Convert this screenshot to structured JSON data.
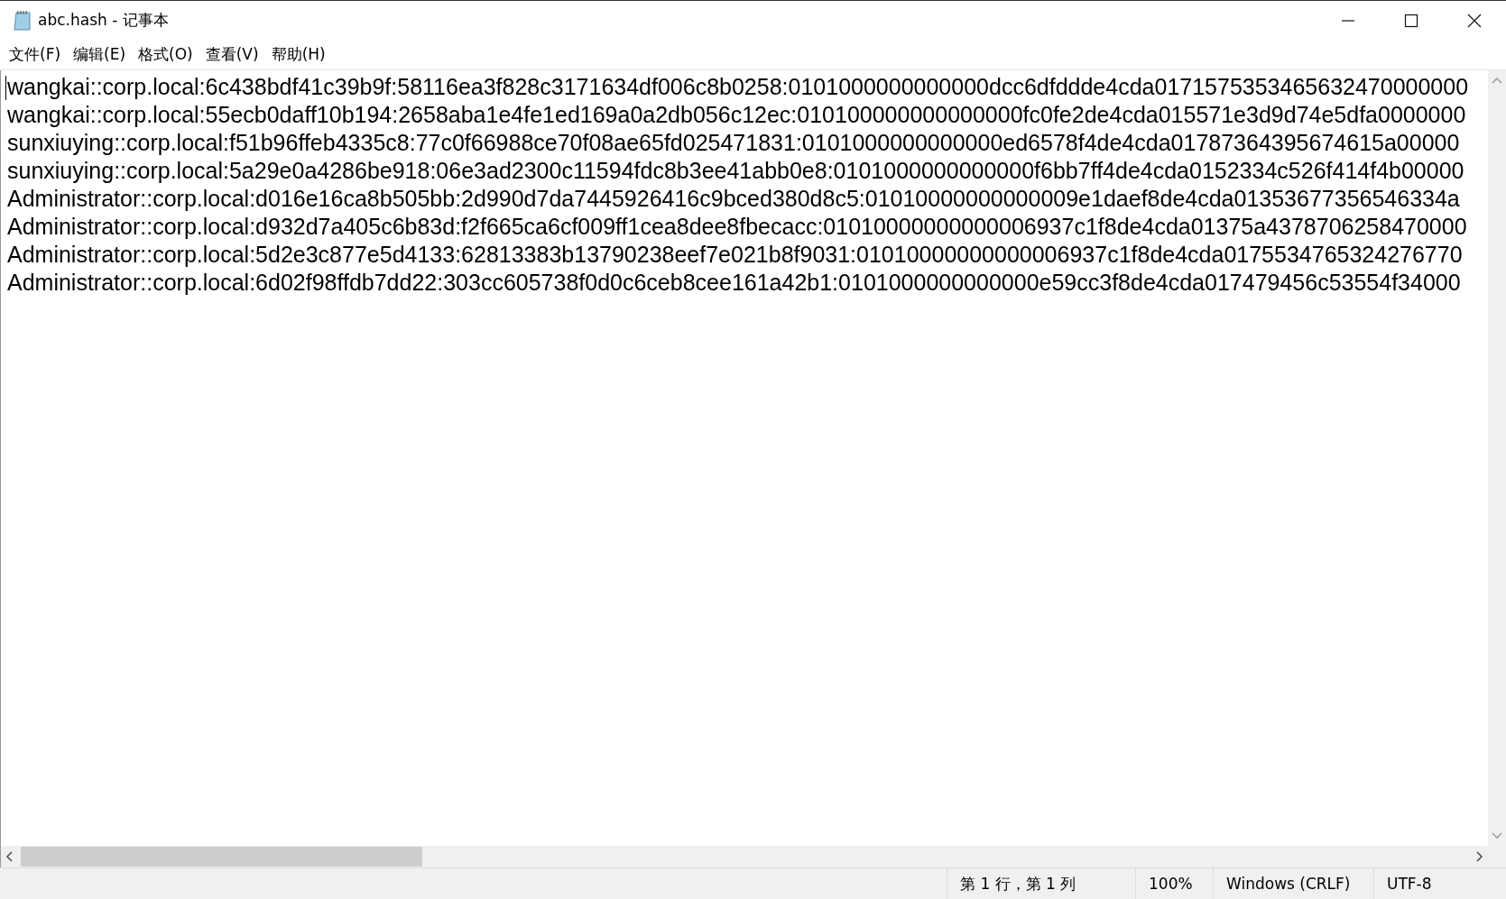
{
  "window": {
    "title": "abc.hash - 记事本"
  },
  "menu": [
    "文件(F)",
    "编辑(E)",
    "格式(O)",
    "查看(V)",
    "帮助(H)"
  ],
  "lines": [
    "wangkai::corp.local:6c438bdf41c39b9f:58116ea3f828c3171634df006c8b0258:0101000000000000dcc6dfddde4cda0171575353465632470000000",
    "wangkai::corp.local:55ecb0daff10b194:2658aba1e4fe1ed169a0a2db056c12ec:010100000000000000fc0fe2de4cda015571e3d9d74e5dfa0000000",
    "sunxiuying::corp.local:f51b96ffeb4335c8:77c0f66988ce70f08ae65fd025471831:0101000000000000ed6578f4de4cda01787364395674615a00000",
    "sunxiuying::corp.local:5a29e0a4286be918:06e3ad2300c11594fdc8b3ee41abb0e8:0101000000000000f6bb7ff4de4cda0152334c526f414f4b00000",
    "Administrator::corp.local:d016e16ca8b505bb:2d990d7da7445926416c9bced380d8c5:01010000000000009e1daef8de4cda01353677356546334a",
    "Administrator::corp.local:d932d7a405c6b83d:f2f665ca6cf009ff1cea8dee8fbecacc:01010000000000006937c1f8de4cda01375a4378706258470000",
    "Administrator::corp.local:5d2e3c877e5d4133:62813383b13790238eef7e021b8f9031:01010000000000006937c1f8de4cda0175534765324276770",
    "Administrator::corp.local:6d02f98ffdb7dd22:303cc605738f0d0c6ceb8cee161a42b1:0101000000000000e59cc3f8de4cda017479456c53554f34000"
  ],
  "status_bar": {
    "position": "第 1 行，第 1 列",
    "zoom": "100%",
    "line_ending": "Windows (CRLF)",
    "encoding": "UTF-8"
  }
}
